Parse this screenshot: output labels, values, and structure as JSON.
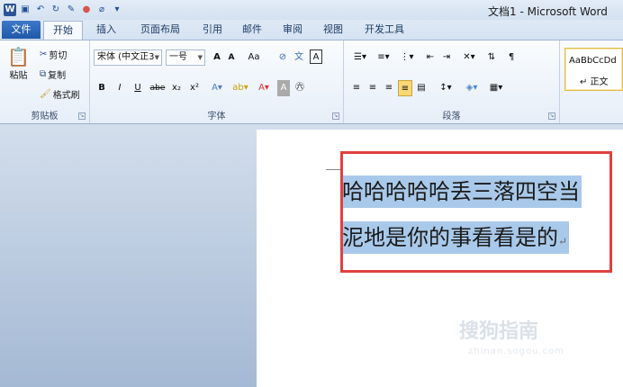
{
  "window": {
    "title": "文档1 - Microsoft Word"
  },
  "tabs": [
    "文件",
    "开始",
    "插入",
    "页面布局",
    "引用",
    "邮件",
    "审阅",
    "视图",
    "开发工具"
  ],
  "clipboard": {
    "paste": "粘贴",
    "cut": "剪切",
    "copy": "复制",
    "format_painter": "格式刷",
    "label": "剪贴板"
  },
  "font": {
    "name": "宋体 (中文正3",
    "size": "一号",
    "grow": "A",
    "shrink": "A",
    "case": "Aa",
    "bold": "B",
    "italic": "I",
    "underline": "U",
    "strike": "abe",
    "subscript": "x₂",
    "superscript": "x²",
    "label": "字体"
  },
  "paragraph": {
    "label": "段落"
  },
  "styles": {
    "sample": "AaBbCcDd",
    "normal": "↵ 正文"
  },
  "document": {
    "line1": "哈哈哈哈哈丢三落四空当",
    "line2": "泥地是你的事看看是的"
  },
  "watermark": {
    "text": "搜狗指南",
    "sub": "zhinan.sogou.com"
  },
  "colors": {
    "selection": "#a9c9ea",
    "callout": "#e0413d",
    "file_tab": "#2a5fae"
  }
}
